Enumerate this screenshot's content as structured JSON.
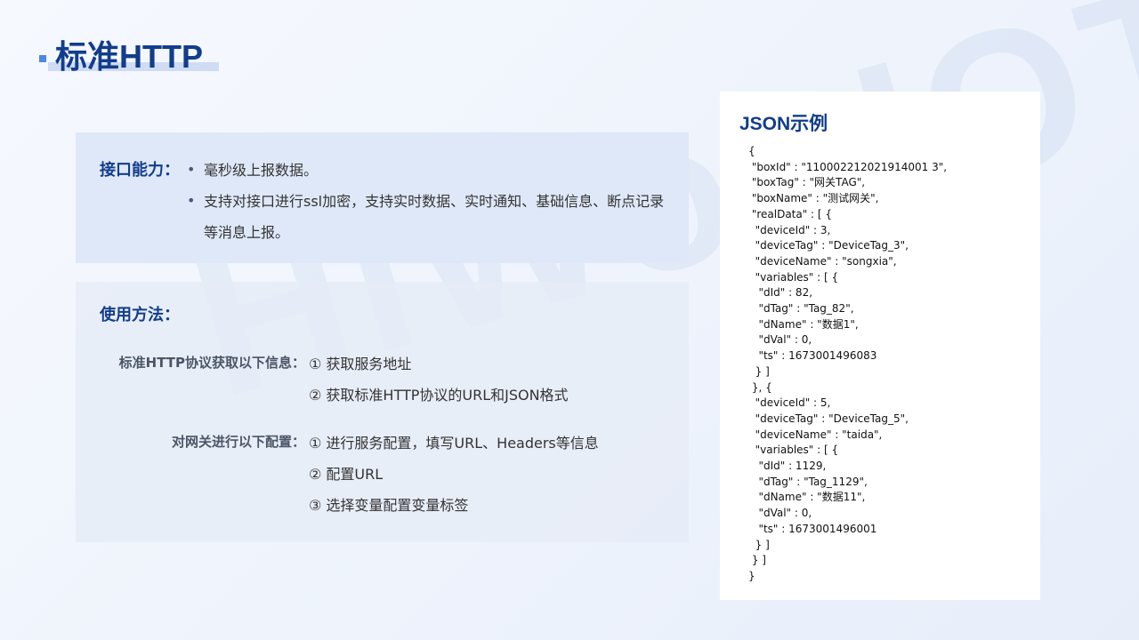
{
  "page": {
    "title": "标准HTTP",
    "watermark": "HiWooIOT"
  },
  "capability": {
    "label": "接口能力：",
    "bullet": "•",
    "items": [
      "毫秒级上报数据。",
      "支持对接口进行ssl加密，支持实时数据、实时通知、基础信息、断点记录等消息上报。"
    ]
  },
  "usage": {
    "label": "使用方法：",
    "groups": [
      {
        "label": "标准HTTP协议获取以下信息：",
        "steps": [
          "① 获取服务地址",
          "② 获取标准HTTP协议的URL和JSON格式"
        ]
      },
      {
        "label": "对网关进行以下配置：",
        "steps": [
          "① 进行服务配置，填写URL、Headers等信息",
          "② 配置URL",
          "③ 选择变量配置变量标签"
        ]
      }
    ]
  },
  "json_example": {
    "title": "JSON示例",
    "code": "{\n \"boxId\" : \"110002212021914001 3\",\n \"boxTag\" : \"网关TAG\",\n \"boxName\" : \"测试网关\",\n \"realData\" : [ {\n  \"deviceId\" : 3,\n  \"deviceTag\" : \"DeviceTag_3\",\n  \"deviceName\" : \"songxia\",\n  \"variables\" : [ {\n   \"dId\" : 82,\n   \"dTag\" : \"Tag_82\",\n   \"dName\" : \"数据1\",\n   \"dVal\" : 0,\n   \"ts\" : 1673001496083\n  } ]\n }, {\n  \"deviceId\" : 5,\n  \"deviceTag\" : \"DeviceTag_5\",\n  \"deviceName\" : \"taida\",\n  \"variables\" : [ {\n   \"dId\" : 1129,\n   \"dTag\" : \"Tag_1129\",\n   \"dName\" : \"数据11\",\n   \"dVal\" : 0,\n   \"ts\" : 1673001496001\n  } ]\n } ]\n}"
  },
  "colors": {
    "accent": "#123d8c",
    "marker": "#4f86e8",
    "panel": "#dfe8f8"
  }
}
